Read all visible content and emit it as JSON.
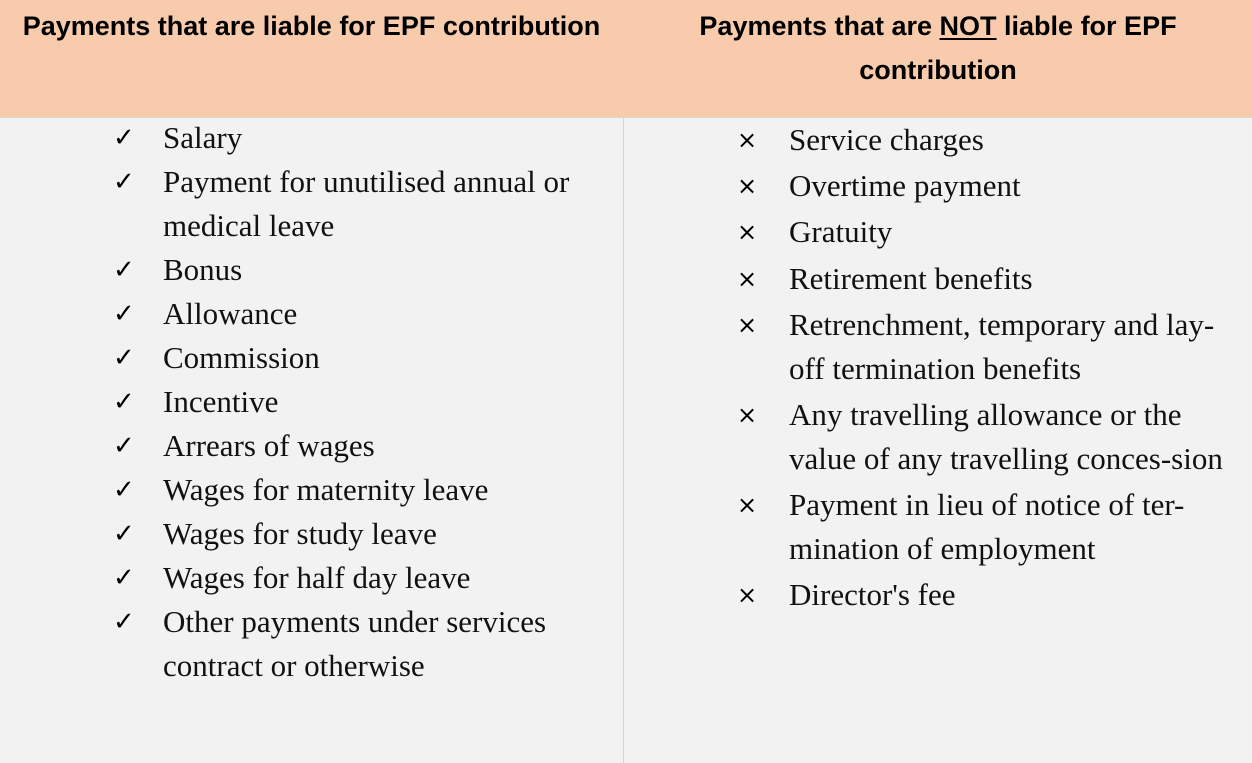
{
  "table": {
    "header_left": "Payments that are liable for EPF contribution",
    "header_right_before": "Payments that are ",
    "header_right_emph": "NOT",
    "header_right_after": " liable for EPF contribution",
    "header_bg": "#f8cbad",
    "body_bg": "#f2f2f2"
  },
  "liable": {
    "mark_icon": "check-icon",
    "mark_glyph": "✓",
    "items": [
      "Salary",
      "Payment for unutilised annual or medical leave",
      "Bonus",
      "Allowance",
      "Commission",
      "Incentive",
      "Arrears of wages",
      "Wages for maternity leave",
      "Wages for study leave",
      "Wages for half day leave",
      "Other payments under services contract or otherwise"
    ]
  },
  "not_liable": {
    "mark_icon": "cross-icon",
    "mark_glyph": "×",
    "items": [
      "Service charges",
      "Overtime payment",
      "Gratuity",
      "Retirement benefits",
      "Retrenchment, temporary and lay-off termination benefits",
      "Any travelling allowance or the value of any travelling conces-sion",
      "Payment in lieu of notice of ter-mination of employment",
      "Director's fee"
    ]
  }
}
